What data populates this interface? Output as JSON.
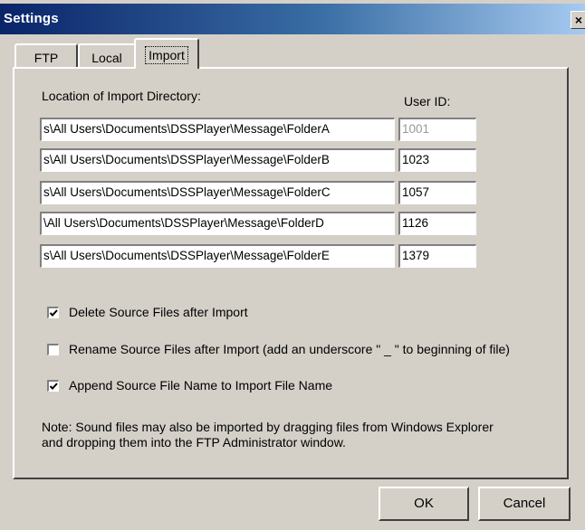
{
  "window": {
    "title": "Settings",
    "close_glyph": "×"
  },
  "tabs": [
    {
      "label": "FTP",
      "active": false
    },
    {
      "label": "Local",
      "active": false
    },
    {
      "label": "Import",
      "active": true
    }
  ],
  "import": {
    "location_label": "Location of Import Directory:",
    "user_id_label": "User ID:",
    "rows": [
      {
        "path": "s\\All Users\\Documents\\DSSPlayer\\Message\\FolderA",
        "user_id": "1001",
        "user_id_disabled": true
      },
      {
        "path": "s\\All Users\\Documents\\DSSPlayer\\Message\\FolderB",
        "user_id": "1023",
        "user_id_disabled": false
      },
      {
        "path": "s\\All Users\\Documents\\DSSPlayer\\Message\\FolderC",
        "user_id": "1057",
        "user_id_disabled": false
      },
      {
        "path": "\\All Users\\Documents\\DSSPlayer\\Message\\FolderD",
        "user_id": "1126",
        "user_id_disabled": false
      },
      {
        "path": "s\\All Users\\Documents\\DSSPlayer\\Message\\FolderE",
        "user_id": "1379",
        "user_id_disabled": false
      }
    ],
    "options": [
      {
        "label": "Delete Source Files after Import",
        "checked": true
      },
      {
        "label": "Rename Source Files after Import (add an underscore \" _ \" to beginning of file)",
        "checked": false
      },
      {
        "label": "Append Source File Name to Import File Name",
        "checked": true
      }
    ],
    "note_line1": "Note:  Sound files may also be imported by dragging files from Windows Explorer",
    "note_line2": "and dropping them into the FTP Administrator window."
  },
  "buttons": {
    "ok_label": "OK",
    "cancel_label": "Cancel"
  },
  "icons": {
    "close": "close-icon",
    "check": "checkmark-icon"
  }
}
